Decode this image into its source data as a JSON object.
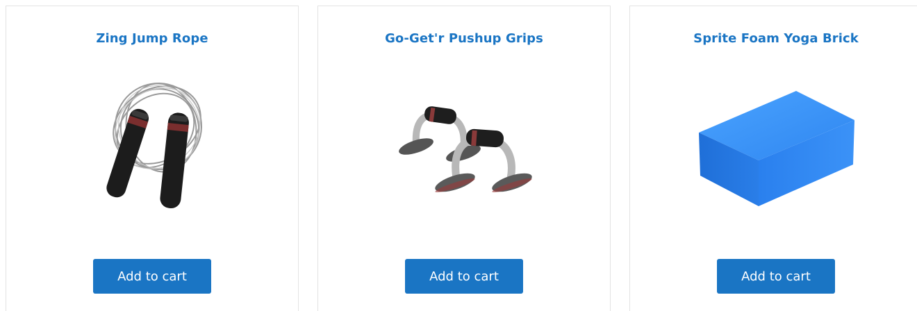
{
  "products": [
    {
      "title": "Zing Jump Rope",
      "button_label": "Add to cart",
      "image_icon": "jump-rope-image"
    },
    {
      "title": "Go-Get'r Pushup Grips",
      "button_label": "Add to cart",
      "image_icon": "pushup-grips-image"
    },
    {
      "title": "Sprite Foam Yoga Brick",
      "button_label": "Add to cart",
      "image_icon": "yoga-brick-image"
    }
  ],
  "colors": {
    "accent": "#1a75c4",
    "card_border": "#e3e3e3",
    "button_text": "#ffffff"
  }
}
